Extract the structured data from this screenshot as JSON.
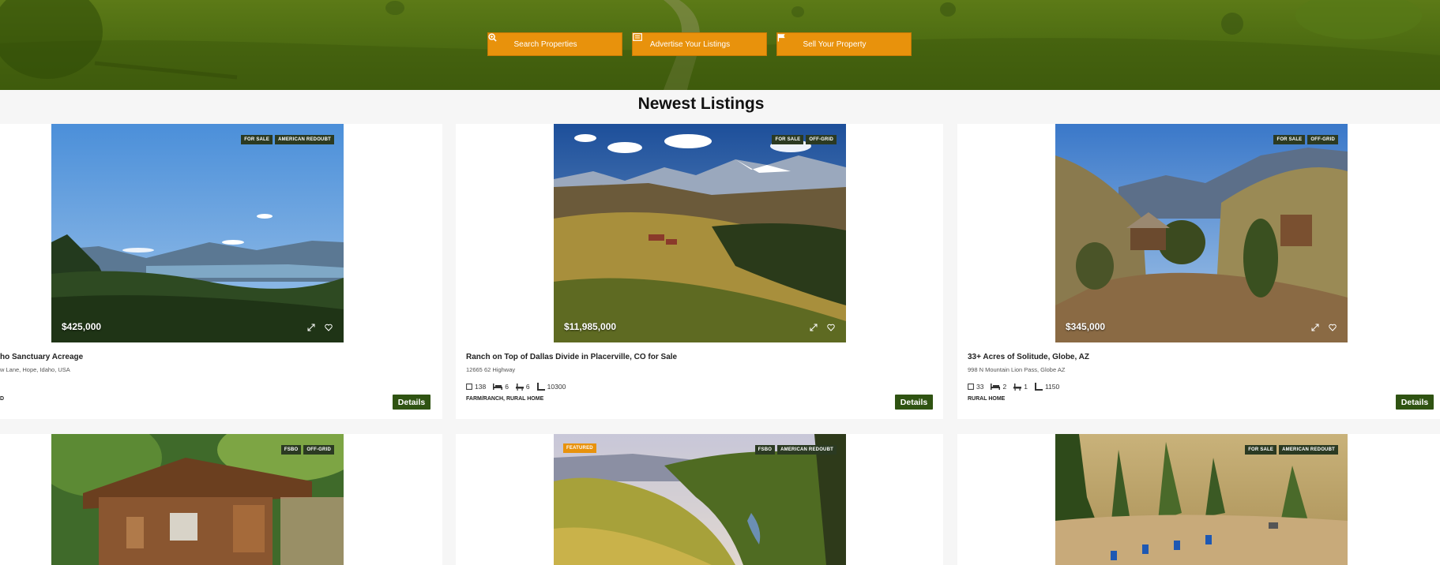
{
  "hero": {
    "buttons": [
      {
        "label": "Search Properties",
        "icon": "search-plus-icon"
      },
      {
        "label": "Advertise Your Listings",
        "icon": "listing-card-icon"
      },
      {
        "label": "Sell Your Property",
        "icon": "flag-icon"
      }
    ],
    "accent_color": "#e8920c"
  },
  "section": {
    "title": "Newest Listings"
  },
  "listings": [
    {
      "badges": [
        "For Sale",
        "American Redoubt"
      ],
      "price": "$425,000",
      "title": "ho Sanctuary Acreage",
      "address": "w Lane, Hope, Idaho, USA",
      "type": "D",
      "details_label": "Details"
    },
    {
      "badges": [
        "For Sale",
        "Off-Grid"
      ],
      "price": "$11,985,000",
      "title": "Ranch on Top of Dallas Divide in Placerville, CO for Sale",
      "address": "12665 62 Highway",
      "acres": "138",
      "beds": "6",
      "baths": "6",
      "sqft": "10300",
      "type": "FARM/RANCH, RURAL HOME",
      "details_label": "Details"
    },
    {
      "badges": [
        "For Sale",
        "Off-Grid"
      ],
      "price": "$345,000",
      "title": "33+ Acres of Solitude, Globe, AZ",
      "address": "998 N Mountain Lion Pass, Globe AZ",
      "acres": "33",
      "beds": "2",
      "baths": "1",
      "sqft": "1150",
      "type": "RURAL HOME",
      "details_label": "Details"
    },
    {
      "badges": [
        "FSBO",
        "Off-Grid"
      ]
    },
    {
      "featured": "Featured",
      "badges": [
        "FSBO",
        "American Redoubt"
      ]
    },
    {
      "badges": [
        "For Sale",
        "American Redoubt"
      ]
    }
  ],
  "colors": {
    "details_button": "#2f5312",
    "badge": "#2b3a22"
  }
}
